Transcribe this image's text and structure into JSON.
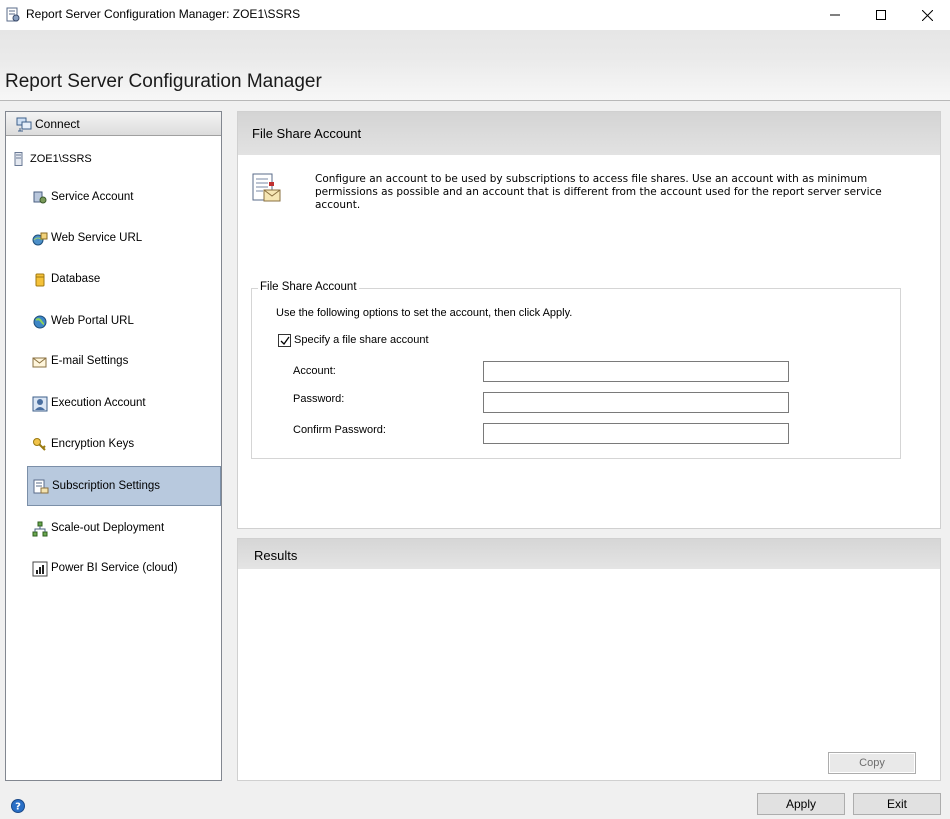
{
  "window": {
    "title": "Report Server Configuration Manager: ZOE1\\SSRS"
  },
  "header": {
    "title": "Report Server Configuration Manager"
  },
  "nav": {
    "connect_label": "Connect",
    "server_label": "ZOE1\\SSRS",
    "items": [
      {
        "label": "Service Account",
        "icon": "service-account-icon"
      },
      {
        "label": "Web Service URL",
        "icon": "web-service-url-icon"
      },
      {
        "label": "Database",
        "icon": "database-icon"
      },
      {
        "label": "Web Portal URL",
        "icon": "globe-icon"
      },
      {
        "label": "E-mail Settings",
        "icon": "email-icon"
      },
      {
        "label": "Execution Account",
        "icon": "execution-account-icon"
      },
      {
        "label": "Encryption Keys",
        "icon": "keys-icon"
      },
      {
        "label": "Subscription Settings",
        "icon": "subscription-icon",
        "selected": true
      },
      {
        "label": "Scale-out Deployment",
        "icon": "scale-out-icon"
      },
      {
        "label": "Power BI Service (cloud)",
        "icon": "power-bi-icon"
      }
    ]
  },
  "main": {
    "header": "File Share Account",
    "description": "Configure an account to be used by subscriptions to access file shares. Use an account with as minimum permissions as possible and an account that is different from the account used for the report server service account.",
    "group": {
      "legend": "File Share Account",
      "hint": "Use the following options to set the account, then click Apply.",
      "checkbox_label": "Specify a file share account",
      "checkbox_checked": true,
      "account_label": "Account:",
      "account_value": "",
      "password_label": "Password:",
      "password_value": "",
      "confirm_label": "Confirm Password:",
      "confirm_value": ""
    }
  },
  "results": {
    "header": "Results",
    "copy_label": "Copy"
  },
  "footer": {
    "apply_label": "Apply",
    "exit_label": "Exit"
  }
}
